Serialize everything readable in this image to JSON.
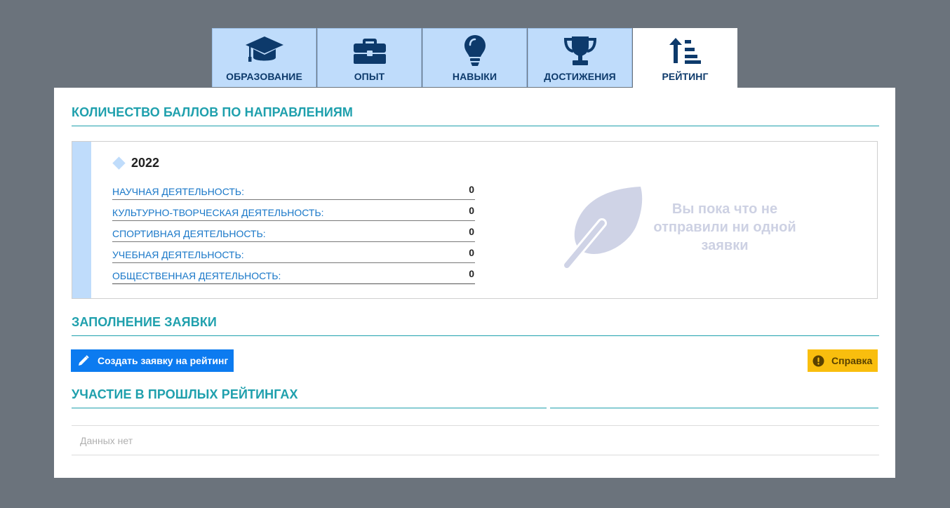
{
  "tabs": [
    {
      "label": "ОБРАЗОВАНИЕ",
      "icon": "graduation-cap-icon"
    },
    {
      "label": "ОПЫТ",
      "icon": "briefcase-icon"
    },
    {
      "label": "НАВЫКИ",
      "icon": "lightbulb-icon"
    },
    {
      "label": "ДОСТИЖЕНИЯ",
      "icon": "trophy-icon"
    },
    {
      "label": "РЕЙТИНГ",
      "icon": "sort-up-icon",
      "active": true
    }
  ],
  "scores_section": {
    "title": "КОЛИЧЕСТВО БАЛЛОВ ПО НАПРАВЛЕНИЯМ",
    "year": "2022",
    "rows": [
      {
        "name": "НАУЧНАЯ ДЕЯТЕЛЬНОСТЬ:",
        "value": "0"
      },
      {
        "name": "КУЛЬТУРНО-ТВОРЧЕСКАЯ ДЕЯТЕЛЬНОСТЬ:",
        "value": "0"
      },
      {
        "name": "СПОРТИВНАЯ ДЕЯТЕЛЬНОСТЬ:",
        "value": "0"
      },
      {
        "name": "УЧЕБНАЯ ДЕЯТЕЛЬНОСТЬ:",
        "value": "0"
      },
      {
        "name": "ОБЩЕСТВЕННАЯ ДЕЯТЕЛЬНОСТЬ:",
        "value": "0"
      }
    ],
    "empty_message": "Вы пока что не отправили ни одной заявки",
    "empty_icon": "feather-icon"
  },
  "application_section": {
    "title": "ЗАПОЛНЕНИЕ ЗАЯВКИ",
    "create_button": "Создать заявку на рейтинг",
    "create_icon": "pencil-icon",
    "help_button": "Справка",
    "help_icon": "exclamation-circle-icon"
  },
  "history_section": {
    "title": "УЧАСТИЕ В ПРОШЛЫХ РЕЙТИНГАХ",
    "empty_text": "Данных нет"
  },
  "colors": {
    "background": "#6b737c",
    "tab_inactive": "#bfdcfb",
    "accent_teal": "#1fa0ad",
    "link_blue": "#1877c8",
    "primary_button": "#0c7bf0",
    "warning_button": "#f9be0e",
    "icon_navy": "#0d3a6b"
  }
}
